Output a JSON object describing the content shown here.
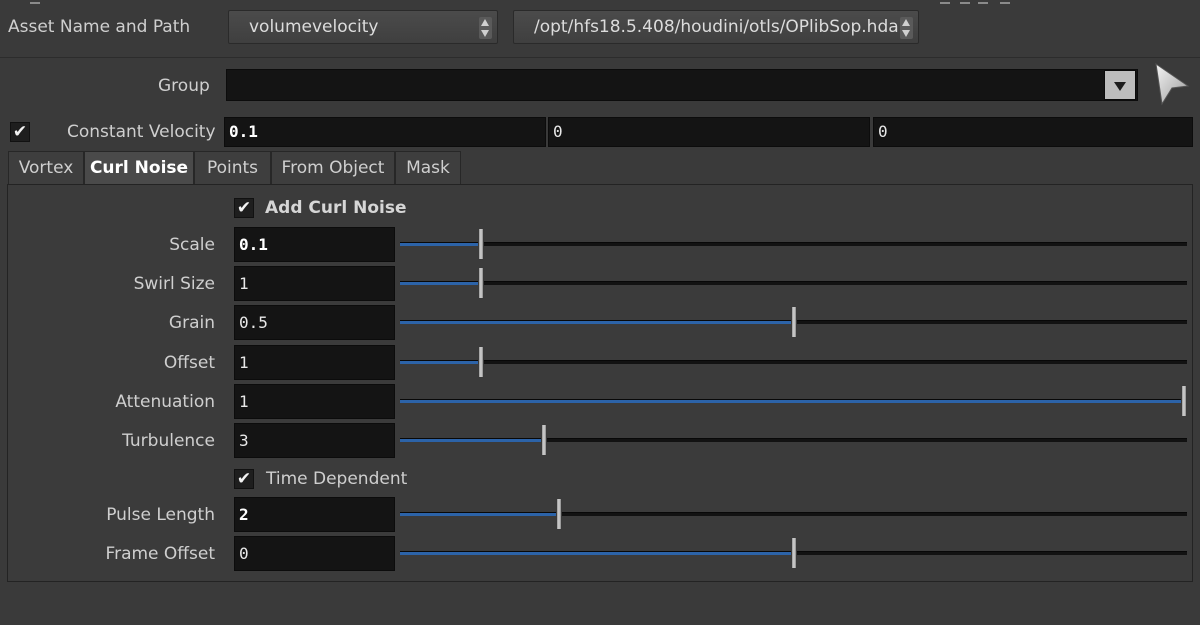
{
  "header": {
    "asset_label": "Asset Name and Path",
    "asset_name": "volumevelocity",
    "asset_path": "/opt/hfs18.5.408/houdini/otls/OPlibSop.hda"
  },
  "group": {
    "label": "Group",
    "value": ""
  },
  "constant_velocity": {
    "label": "Constant Velocity",
    "checkmark": "✔",
    "values": [
      "0.1",
      "0",
      "0"
    ]
  },
  "tabs": [
    {
      "label": "Vortex"
    },
    {
      "label": "Curl Noise"
    },
    {
      "label": "Points"
    },
    {
      "label": "From Object"
    },
    {
      "label": "Mask"
    }
  ],
  "active_tab": "Curl Noise",
  "curl_noise": {
    "add_curl_noise": {
      "label": "Add Curl Noise",
      "checkmark": "✔"
    },
    "time_dependent": {
      "label": "Time Dependent",
      "checkmark": "✔"
    },
    "params": [
      {
        "label": "Scale",
        "value": "0.1",
        "slider_fraction": 0.1
      },
      {
        "label": "Swirl Size",
        "value": "1",
        "slider_fraction": 0.1
      },
      {
        "label": "Grain",
        "value": "0.5",
        "slider_fraction": 0.5
      },
      {
        "label": "Offset",
        "value": "1",
        "slider_fraction": 0.1
      },
      {
        "label": "Attenuation",
        "value": "1",
        "slider_fraction": 1.0
      },
      {
        "label": "Turbulence",
        "value": "3",
        "slider_fraction": 0.18
      },
      {
        "label": "Pulse Length",
        "value": "2",
        "slider_fraction": 0.2
      },
      {
        "label": "Frame Offset",
        "value": "0",
        "slider_fraction": 0.5
      }
    ]
  },
  "colors": {
    "background": "#3a3a3a",
    "field": "#141414",
    "slider_fill": "#2c63a8"
  }
}
